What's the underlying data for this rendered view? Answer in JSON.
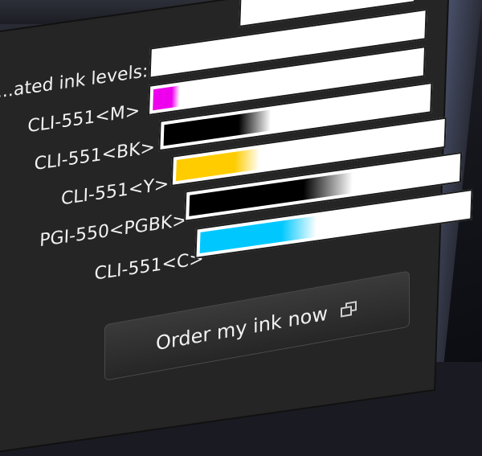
{
  "ink": {
    "heading": "...ated ink levels:",
    "cartridges": [
      {
        "label": "CLI-551<M>",
        "level": 0.12,
        "color": "#ee00ee"
      },
      {
        "label": "CLI-551<BK>",
        "level": 0.42,
        "color": "#000000"
      },
      {
        "label": "CLI-551<Y>",
        "level": 0.33,
        "color": "#ffcc00"
      },
      {
        "label": "PGI-550<PGBK>",
        "level": 0.62,
        "color": "#000000"
      },
      {
        "label": "CLI-551<C>",
        "level": 0.45,
        "color": "#00c8ff"
      }
    ]
  },
  "actions": {
    "order_label": "Order my ink now"
  }
}
